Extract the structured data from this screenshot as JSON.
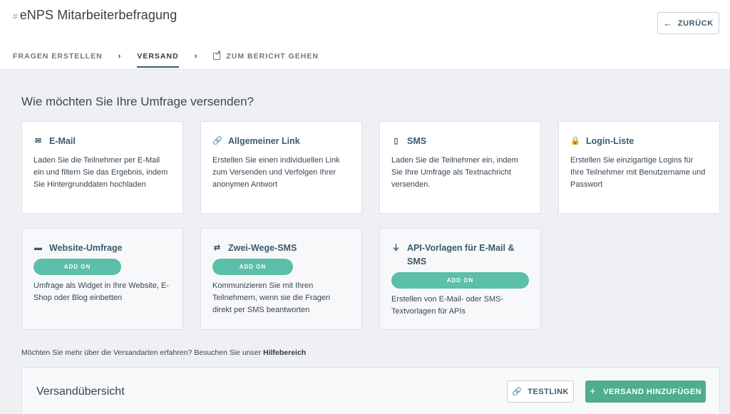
{
  "header": {
    "hash": "#",
    "title": "eNPS Mitarbeiterbefragung",
    "back_label": "ZURÜCK"
  },
  "steps": {
    "create": "FRAGEN ERSTELLEN",
    "send": "VERSAND",
    "report": "ZUM BERICHT GEHEN",
    "chevron": "›"
  },
  "question": "Wie möchten Sie Ihre Umfrage versenden?",
  "cards": [
    {
      "title": "E-Mail",
      "icon": "envelope-icon",
      "glyph": "✉",
      "text": "Laden Sie die Teilnehmer per E-Mail ein und filtern Sie das Ergebnis, indem Sie Hintergrunddaten hochladen"
    },
    {
      "title": "Allgemeiner Link",
      "icon": "link-icon",
      "glyph": "🔗",
      "text": "Erstellen Sie einen individuellen Link zum Versenden und Verfolgen Ihrer anonymen Antwort"
    },
    {
      "title": "SMS",
      "icon": "phone-icon",
      "glyph": "▯",
      "text": "Laden Sie die Teilnehmer ein, indem Sie Ihre Umfrage als Textnachricht versenden."
    },
    {
      "title": "Login-Liste",
      "icon": "lock-icon",
      "glyph": "🔒",
      "text": "Erstellen Sie einzigartige Logins für Ihre Teilnehmer mit Benutzername und Passwort"
    },
    {
      "title": "Website-Umfrage",
      "icon": "browser-icon",
      "glyph": "▬",
      "addon": "ADD ON",
      "text": "Umfrage als Widget in Ihre Website, E-Shop oder Blog einbetten"
    },
    {
      "title": "Zwei-Wege-SMS",
      "icon": "exchange-icon",
      "glyph": "⇄",
      "addon": "ADD ON",
      "text": "Kommunizieren Sie mit Ihren Teilnehmern, wenn sie die Fragen direkt per SMS beantworten"
    },
    {
      "title": "API-Vorlagen für E-Mail & SMS",
      "icon": "plug-icon",
      "glyph": "⏚",
      "addon": "ADD ON",
      "text": "Erstellen von E-Mail- oder SMS-Textvorlagen für APIs"
    }
  ],
  "help": {
    "text": "Möchten Sie mehr über die Versandarten erfahren? Besuchen Sie unser ",
    "link": "Hilfebereich"
  },
  "overview": {
    "title": "Versandübersicht",
    "testlink_label": "TESTLINK",
    "add_label": "VERSAND HINZUFÜGEN"
  }
}
